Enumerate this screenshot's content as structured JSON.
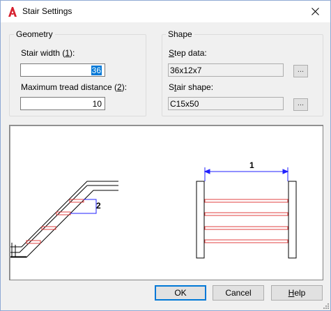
{
  "window": {
    "title": "Stair Settings"
  },
  "geometry": {
    "group_title": "Geometry",
    "stair_width": {
      "label_pre": "Stair width (",
      "hotkey": "1",
      "label_post": "):",
      "value": "36"
    },
    "max_tread": {
      "label_pre": "Maximum tread distance (",
      "hotkey": "2",
      "label_post": "):",
      "value": "10"
    }
  },
  "shape": {
    "group_title": "Shape",
    "step_data": {
      "hotkey": "S",
      "label_rest": "tep data:",
      "value": "36x12x7",
      "browse": "..."
    },
    "stair_shape": {
      "pre": "S",
      "hotkey": "t",
      "label_rest": "air shape:",
      "value": "C15x50",
      "browse": "..."
    }
  },
  "preview": {
    "dim_1": "1",
    "dim_2": "2"
  },
  "buttons": {
    "ok": "OK",
    "cancel": "Cancel",
    "help_hotkey": "H",
    "help_rest": "elp"
  },
  "colors": {
    "tread_red": "#e04040",
    "dim_blue": "#2020ff"
  }
}
